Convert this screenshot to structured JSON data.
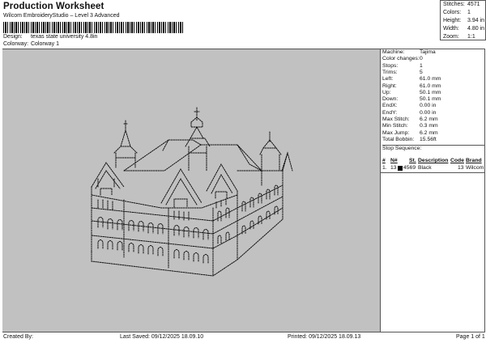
{
  "header": {
    "title": "Production Worksheet",
    "subtitle": "Wilcom EmbroideryStudio – Level 3 Advanced",
    "design_label": "Design:",
    "design_value": "texas state university 4.8in",
    "colorway_label": "Colorway:",
    "colorway_value": "Colorway 1"
  },
  "stats": [
    {
      "label": "Stitches:",
      "value": "4571"
    },
    {
      "label": "Colors:",
      "value": "1"
    },
    {
      "label": "Height:",
      "value": "3.94 in"
    },
    {
      "label": "Width:",
      "value": "4.80 in"
    },
    {
      "label": "Zoom:",
      "value": "1:1"
    }
  ],
  "machine_info": [
    {
      "label": "Machine:",
      "value": "Tajima"
    },
    {
      "label": "Color changes:",
      "value": "0"
    },
    {
      "label": "Stops:",
      "value": "1"
    },
    {
      "label": "Trims:",
      "value": "5"
    },
    {
      "label": "Left:",
      "value": "61.0 mm"
    },
    {
      "label": "Right:",
      "value": "61.0 mm"
    },
    {
      "label": "Up:",
      "value": "50.1 mm"
    },
    {
      "label": "Down:",
      "value": "50.1 mm"
    },
    {
      "label": "EndX:",
      "value": "0.00 in"
    },
    {
      "label": "EndY:",
      "value": "0.00 in"
    },
    {
      "label": "Max Stitch:",
      "value": "6.2 mm"
    },
    {
      "label": "Min Stitch:",
      "value": "0.3 mm"
    },
    {
      "label": "Max Jump:",
      "value": "6.2 mm"
    },
    {
      "label": "Total Bobbin:",
      "value": "15.56ft"
    }
  ],
  "stop_sequence": {
    "title": "Stop Sequence:",
    "headers": [
      "#",
      "N#",
      "St.",
      "Description",
      "Code",
      "Brand"
    ],
    "rows": [
      {
        "num": "1.",
        "n": "13",
        "st": "4569",
        "description": "Black",
        "code": "13",
        "brand": "Wilcom",
        "color": "#000000"
      }
    ]
  },
  "footer": {
    "created": "Created By:",
    "last_saved": "Last Saved: 09/12/2025 18.09.10",
    "printed": "Printed: 09/12/2025 18.09.13",
    "page": "Page 1 of 1"
  },
  "colors": {
    "canvas_bg": "#c1c1c1",
    "stitch": "#111111"
  }
}
